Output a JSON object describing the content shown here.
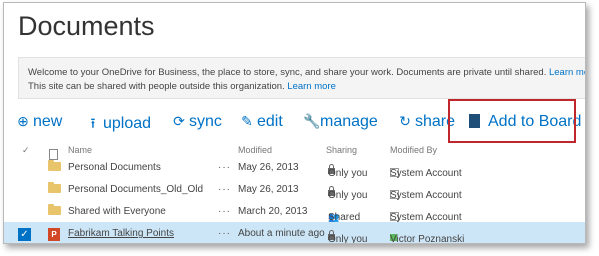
{
  "title": "Documents",
  "banner": {
    "line1": "Welcome to your OneDrive for Business, the place to store, sync, and share your work. Documents are private until shared.",
    "line1_link": "Learn more her",
    "line2": "This site can be shared with people outside this organization.",
    "line2_link": "Learn more"
  },
  "toolbar": {
    "new": "new",
    "upload": "upload",
    "sync": "sync",
    "edit": "edit",
    "manage": "manage",
    "share": "share",
    "add_to_board": "Add to Board"
  },
  "columns": {
    "name": "Name",
    "modified": "Modified",
    "sharing": "Sharing",
    "modified_by": "Modified By"
  },
  "rows": [
    {
      "name": "Personal Documents",
      "modified": "May 26, 2013",
      "sharing": "Only you",
      "modified_by": "System Account"
    },
    {
      "name": "Personal Documents_Old_Old",
      "modified": "May 26, 2013",
      "sharing": "Only you",
      "modified_by": "System Account"
    },
    {
      "name": "Shared with Everyone",
      "modified": "March 20, 2013",
      "sharing": "Shared",
      "modified_by": "System Account"
    },
    {
      "name": "Fabrikam Talking Points",
      "modified": "About a minute ago",
      "sharing": "Only you",
      "modified_by": "Victor Poznanski"
    }
  ],
  "ellipsis": "···",
  "colors": {
    "accent": "#0072c6",
    "highlight": "#c0272d",
    "selected_row": "#cde6f7"
  }
}
